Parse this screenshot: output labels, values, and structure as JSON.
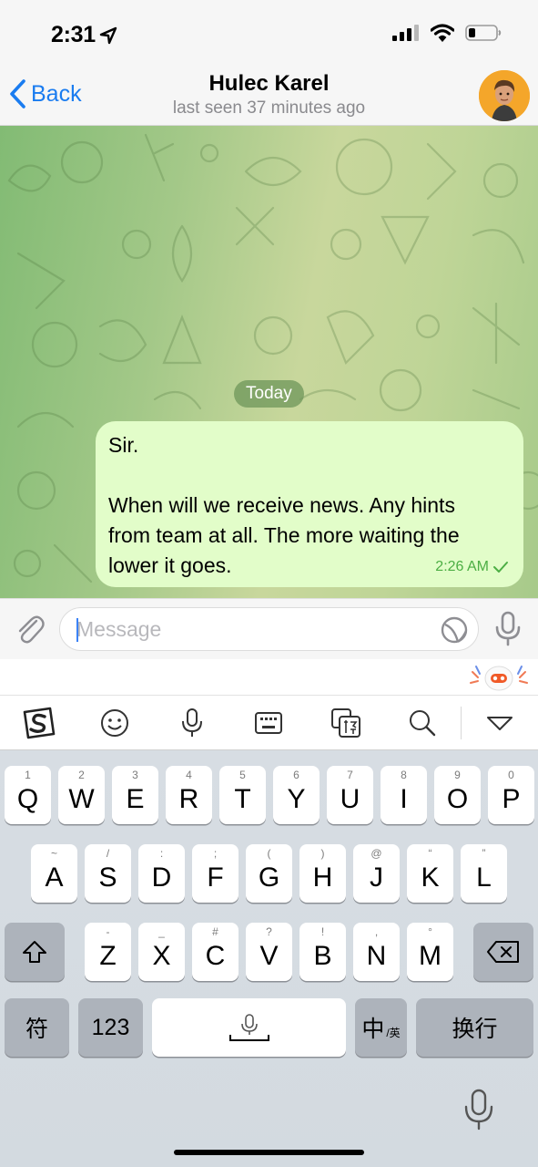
{
  "status_bar": {
    "time": "2:31",
    "location_icon": "location-arrow-icon",
    "signal_icon": "cellular-signal-icon",
    "wifi_icon": "wifi-icon",
    "battery_icon": "battery-icon"
  },
  "nav": {
    "back_label": "Back",
    "title": "Hulec Karel",
    "subtitle": "last seen 37 minutes ago"
  },
  "chat": {
    "date_label": "Today",
    "messages": [
      {
        "direction": "outgoing",
        "line1": "Sir.",
        "line2": "When will we receive news. Any hints",
        "line3": "from team at all. The more waiting the",
        "line4": "lower it goes.",
        "time": "2:26 AM",
        "status": "sent"
      }
    ]
  },
  "input": {
    "placeholder": "Message",
    "value": ""
  },
  "keyboard": {
    "row1": [
      {
        "hint": "1",
        "label": "Q"
      },
      {
        "hint": "2",
        "label": "W"
      },
      {
        "hint": "3",
        "label": "E"
      },
      {
        "hint": "4",
        "label": "R"
      },
      {
        "hint": "5",
        "label": "T"
      },
      {
        "hint": "6",
        "label": "Y"
      },
      {
        "hint": "7",
        "label": "U"
      },
      {
        "hint": "8",
        "label": "I"
      },
      {
        "hint": "9",
        "label": "O"
      },
      {
        "hint": "0",
        "label": "P"
      }
    ],
    "row2": [
      {
        "hint": "~",
        "label": "A"
      },
      {
        "hint": "/",
        "label": "S"
      },
      {
        "hint": ":",
        "label": "D"
      },
      {
        "hint": ";",
        "label": "F"
      },
      {
        "hint": "(",
        "label": "G"
      },
      {
        "hint": ")",
        "label": "H"
      },
      {
        "hint": "@",
        "label": "J"
      },
      {
        "hint": "“",
        "label": "K"
      },
      {
        "hint": "”",
        "label": "L"
      }
    ],
    "row3": [
      {
        "hint": "-",
        "label": "Z"
      },
      {
        "hint": "_",
        "label": "X"
      },
      {
        "hint": "#",
        "label": "C"
      },
      {
        "hint": "?",
        "label": "V"
      },
      {
        "hint": "!",
        "label": "B"
      },
      {
        "hint": ",",
        "label": "N"
      },
      {
        "hint": "°",
        "label": "M"
      }
    ],
    "symbols_label": "符",
    "numbers_label": "123",
    "lang_label": "中",
    "lang_sub": "/英",
    "return_label": "换行"
  }
}
